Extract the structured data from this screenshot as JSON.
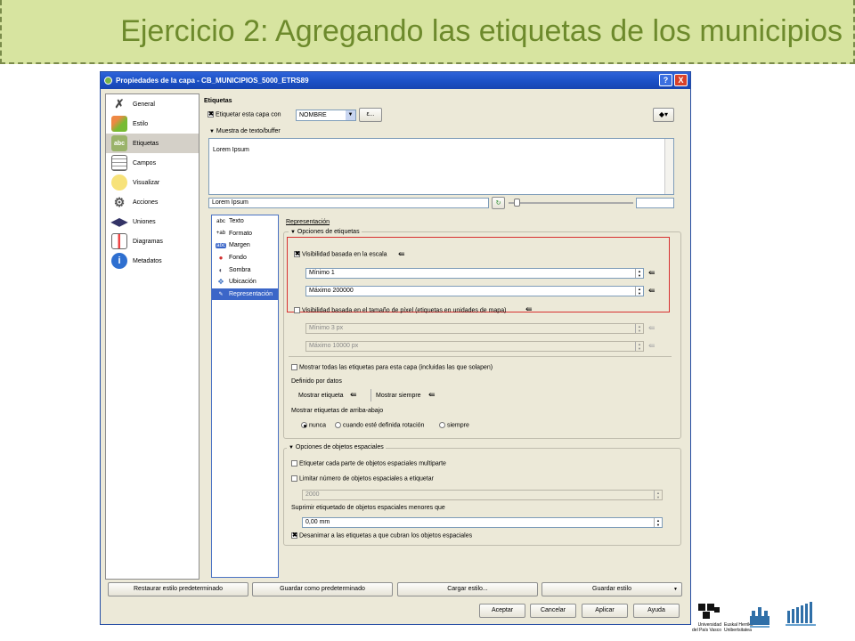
{
  "slide": {
    "title": "Ejercicio 2: Agregando las etiquetas de los municipios"
  },
  "window": {
    "title": "Propiedades de la capa - CB_MUNICIPIOS_5000_ETRS89",
    "help": "?",
    "close": "X"
  },
  "sidebar": {
    "items": [
      {
        "label": "General",
        "icon": "tools-icon"
      },
      {
        "label": "Estilo",
        "icon": "style-icon"
      },
      {
        "label": "Etiquetas",
        "icon": "abc-labels-icon",
        "active": true
      },
      {
        "label": "Campos",
        "icon": "table-fields-icon"
      },
      {
        "label": "Visualizar",
        "icon": "speech-bubble-icon"
      },
      {
        "label": "Acciones",
        "icon": "gears-icon"
      },
      {
        "label": "Uniones",
        "icon": "join-icon"
      },
      {
        "label": "Diagramas",
        "icon": "diagram-icon"
      },
      {
        "label": "Metadatos",
        "icon": "info-icon"
      }
    ]
  },
  "labels": {
    "section": "Etiquetas",
    "label_layer_with": "Etiquetar esta capa con",
    "field_value": "NOMBRE",
    "expr_button": "ε...",
    "sample_header": "Muestra de texto/buffer",
    "sample_text": "Lorem Ipsum",
    "sample_input": "Lorem Ipsum"
  },
  "subnav": {
    "items": [
      {
        "label": "Texto",
        "icon": "abc"
      },
      {
        "label": "Formato",
        "icon": "+ab"
      },
      {
        "label": "Margen",
        "icon": "abc"
      },
      {
        "label": "Fondo",
        "icon": "●"
      },
      {
        "label": "Sombra",
        "icon": "◐"
      },
      {
        "label": "Ubicación",
        "icon": "✥"
      },
      {
        "label": "Representación",
        "icon": "✎",
        "active": true
      }
    ]
  },
  "render": {
    "title": "Representación",
    "label_options": "Opciones de etiquetas",
    "scale_visibility": "Visibilidad basada en la escala",
    "min_scale": "Mínimo 1",
    "max_scale": "Máximo 200000",
    "pixel_visibility": "Visibilidad basada en el tamaño de píxel (etiquetas en unidades de mapa)",
    "min_px": "Mínimo 3 px",
    "max_px": "Máximo 10000 px",
    "show_all": "Mostrar todas las etiquetas para esta capa (incluidas las que solapen)",
    "data_defined": "Definido por datos",
    "show_label": "Mostrar etiqueta",
    "always_show": "Mostrar siempre",
    "upside_down": "Mostrar etiquetas de arriba-abajo",
    "radio": [
      "nunca",
      "cuando esté definida rotación",
      "siempre"
    ],
    "feature_options": "Opciones de objetos espaciales",
    "multipart": "Etiquetar cada parte de objetos espaciales multiparte",
    "limit_features": "Limitar número de objetos espaciales a etiquetar",
    "limit_value": "2000",
    "suppress": "Suprimir etiquetado de objetos espaciales menores que",
    "suppress_value": "0,00 mm",
    "discourage": "Desanimar a las etiquetas a que cubran los objetos espaciales"
  },
  "style_buttons": [
    "Restaurar estilo predeterminado",
    "Guardar como predeterminado",
    "Cargar estilo...",
    "Guardar estilo"
  ],
  "dialog_buttons": [
    "Aceptar",
    "Cancelar",
    "Aplicar",
    "Ayuda"
  ],
  "footer": {
    "upv_line1": "Universidad",
    "upv_line2": "del País Vasco",
    "ehu_line1": "Euskal Herriko",
    "ehu_line2": "Unibertsitatea"
  }
}
